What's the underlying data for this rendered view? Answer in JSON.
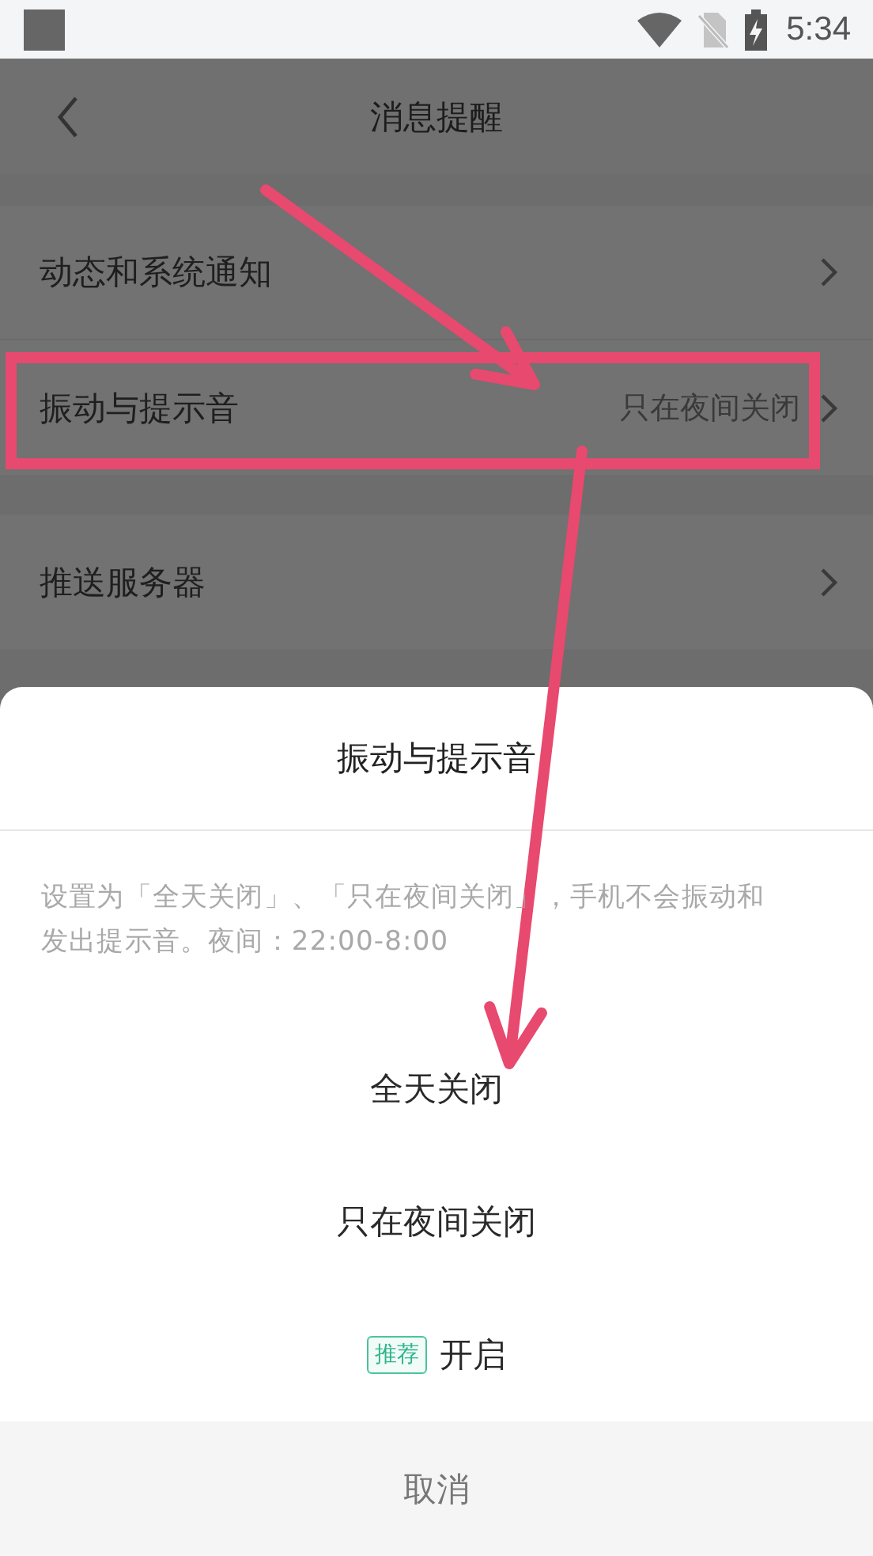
{
  "status_bar": {
    "time": "5:34"
  },
  "header": {
    "title": "消息提醒"
  },
  "settings": [
    {
      "label": "动态和系统通知"
    },
    {
      "label": "振动与提示音",
      "value": "只在夜间关闭"
    },
    {
      "label": "推送服务器"
    }
  ],
  "sheet": {
    "title": "振动与提示音",
    "description": "设置为「全天关闭」、「只在夜间关闭」，手机不会振动和发出提示音。夜间：22:00-8:00",
    "options": [
      {
        "label": "全天关闭"
      },
      {
        "label": "只在夜间关闭"
      },
      {
        "label": "开启",
        "badge": "推荐"
      }
    ],
    "cancel": "取消"
  },
  "annotations": [
    {
      "kind": "frame"
    },
    {
      "kind": "arrow"
    },
    {
      "kind": "arrow"
    }
  ]
}
